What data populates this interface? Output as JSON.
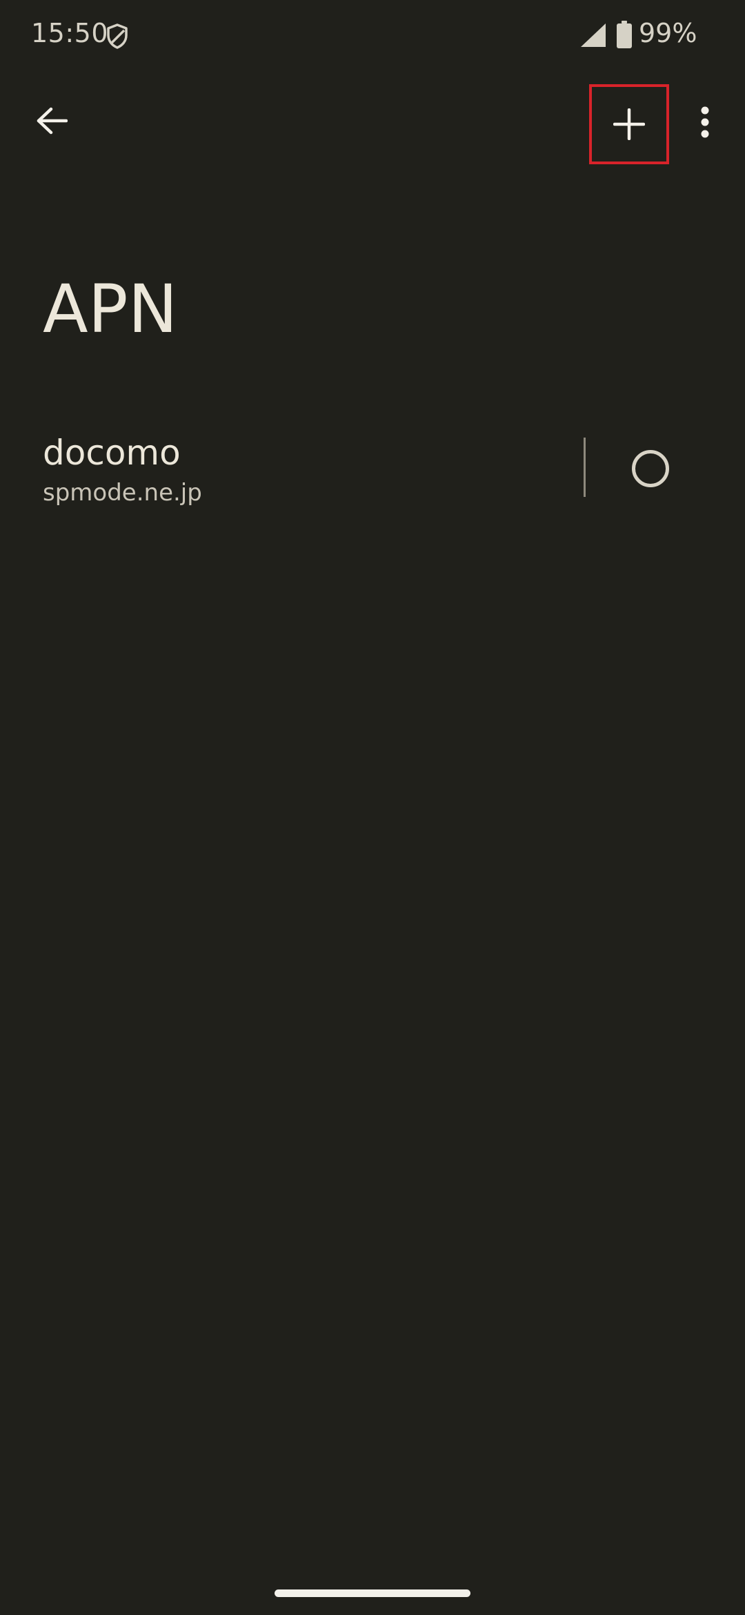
{
  "status_bar": {
    "time": "15:50",
    "battery_percent": "99%",
    "icons": [
      "shield-icon",
      "cell-signal-icon",
      "battery-icon"
    ]
  },
  "app_bar": {
    "back_icon": "arrow-back-icon",
    "add_icon": "plus-icon",
    "more_icon": "more-vert-icon",
    "highlight_color": "#d8232a"
  },
  "page": {
    "title": "APN"
  },
  "apn_list": [
    {
      "name": "docomo",
      "apn": "spmode.ne.jp",
      "selected": false
    }
  ],
  "colors": {
    "background": "#20201b",
    "text_primary": "#ece7da",
    "text_secondary": "#c9c4b7"
  }
}
